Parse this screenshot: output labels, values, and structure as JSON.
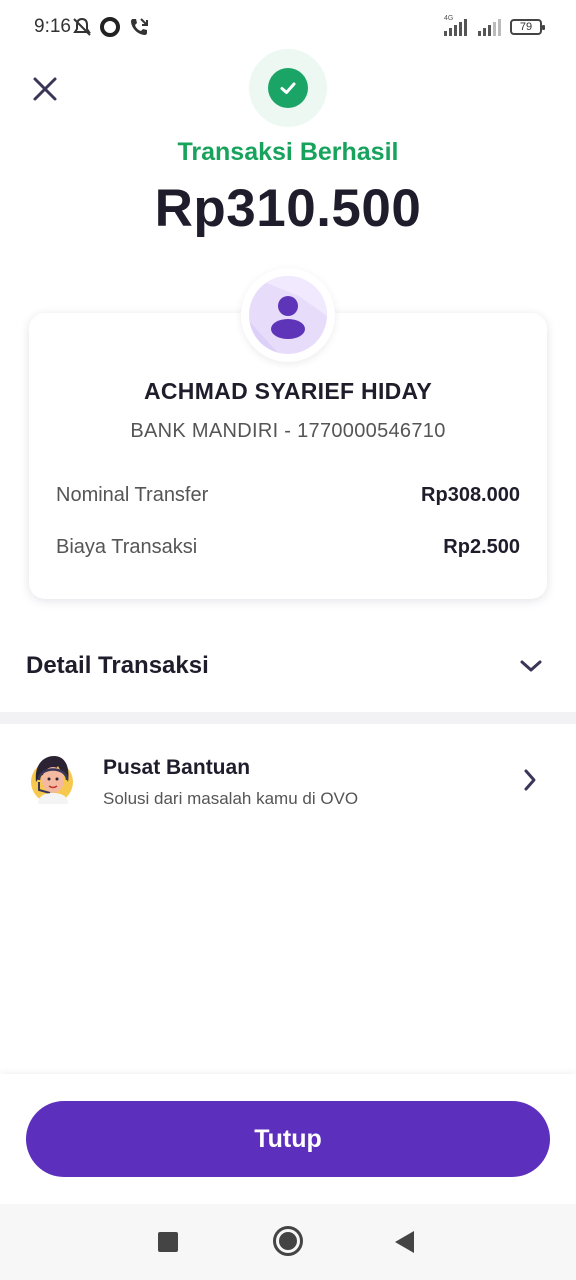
{
  "status_bar": {
    "time": "9:16",
    "network": "4G",
    "battery": "79",
    "icons": [
      "bell-off-icon",
      "circle-icon",
      "call-icon",
      "signal-icon",
      "battery-icon"
    ]
  },
  "header": {
    "status_title": "Transaksi Berhasil",
    "amount": "Rp310.500",
    "accent_color": "#17a35c"
  },
  "recipient": {
    "name": "ACHMAD SYARIEF HIDAY",
    "bank": "BANK MANDIRI - 1770000546710",
    "rows": [
      {
        "label": "Nominal Transfer",
        "value": "Rp308.000"
      },
      {
        "label": "Biaya Transaksi",
        "value": "Rp2.500"
      }
    ]
  },
  "detail": {
    "title": "Detail Transaksi"
  },
  "help": {
    "title": "Pusat Bantuan",
    "subtitle": "Solusi dari masalah kamu di OVO"
  },
  "footer": {
    "button_label": "Tutup",
    "button_color": "#5c2fbd"
  }
}
